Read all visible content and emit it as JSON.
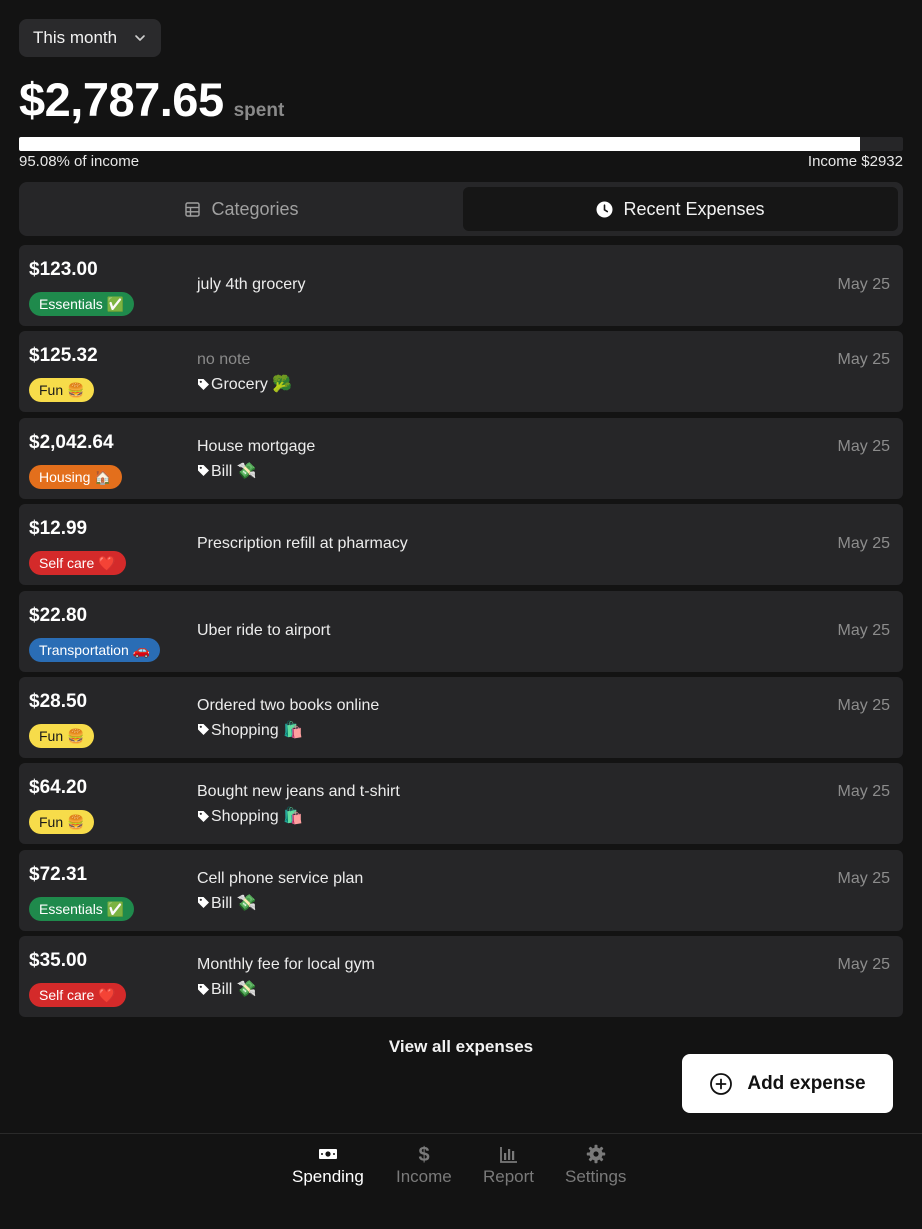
{
  "period": {
    "label": "This month"
  },
  "summary": {
    "total": "$2,787.65",
    "spent_label": "spent",
    "percent_of_income": 95.08,
    "percent_label": "95.08% of income",
    "income_label": "Income $2932"
  },
  "tabs": [
    {
      "label": "Categories",
      "icon": "grid-icon",
      "active": false
    },
    {
      "label": "Recent Expenses",
      "icon": "clock-icon",
      "active": true
    }
  ],
  "colors": {
    "essentials": "#1f8a4c",
    "fun": "#f7dc4a",
    "housing": "#e36f1c",
    "selfcare": "#d42a2a",
    "transportation": "#2a6db5"
  },
  "expenses": [
    {
      "amount": "$123.00",
      "category": "Essentials ✅",
      "cat_key": "essentials",
      "note": "july 4th grocery",
      "tag": "",
      "date": "May 25"
    },
    {
      "amount": "$125.32",
      "category": "Fun 🍔",
      "cat_key": "fun",
      "note": "no note",
      "tag": "Grocery 🥦",
      "date": "May 25"
    },
    {
      "amount": "$2,042.64",
      "category": "Housing 🏠",
      "cat_key": "housing",
      "note": "House mortgage",
      "tag": "Bill 💸",
      "date": "May 25"
    },
    {
      "amount": "$12.99",
      "category": "Self care ❤️",
      "cat_key": "selfcare",
      "note": "Prescription refill at pharmacy",
      "tag": "",
      "date": "May 25"
    },
    {
      "amount": "$22.80",
      "category": "Transportation 🚗",
      "cat_key": "transportation",
      "note": "Uber ride to airport",
      "tag": "",
      "date": "May 25"
    },
    {
      "amount": "$28.50",
      "category": "Fun 🍔",
      "cat_key": "fun",
      "note": "Ordered two books online",
      "tag": "Shopping 🛍️",
      "date": "May 25"
    },
    {
      "amount": "$64.20",
      "category": "Fun 🍔",
      "cat_key": "fun",
      "note": "Bought new jeans and t-shirt",
      "tag": "Shopping 🛍️",
      "date": "May 25"
    },
    {
      "amount": "$72.31",
      "category": "Essentials ✅",
      "cat_key": "essentials",
      "note": "Cell phone service plan",
      "tag": "Bill 💸",
      "date": "May 25"
    },
    {
      "amount": "$35.00",
      "category": "Self care ❤️",
      "cat_key": "selfcare",
      "note": "Monthly fee for local gym",
      "tag": "Bill 💸",
      "date": "May 25"
    }
  ],
  "actions": {
    "view_all": "View all expenses",
    "add_expense": "Add expense"
  },
  "nav": [
    {
      "label": "Spending",
      "icon": "cash-icon",
      "active": true
    },
    {
      "label": "Income",
      "icon": "dollar-icon",
      "active": false
    },
    {
      "label": "Report",
      "icon": "chart-icon",
      "active": false
    },
    {
      "label": "Settings",
      "icon": "gear-icon",
      "active": false
    }
  ]
}
